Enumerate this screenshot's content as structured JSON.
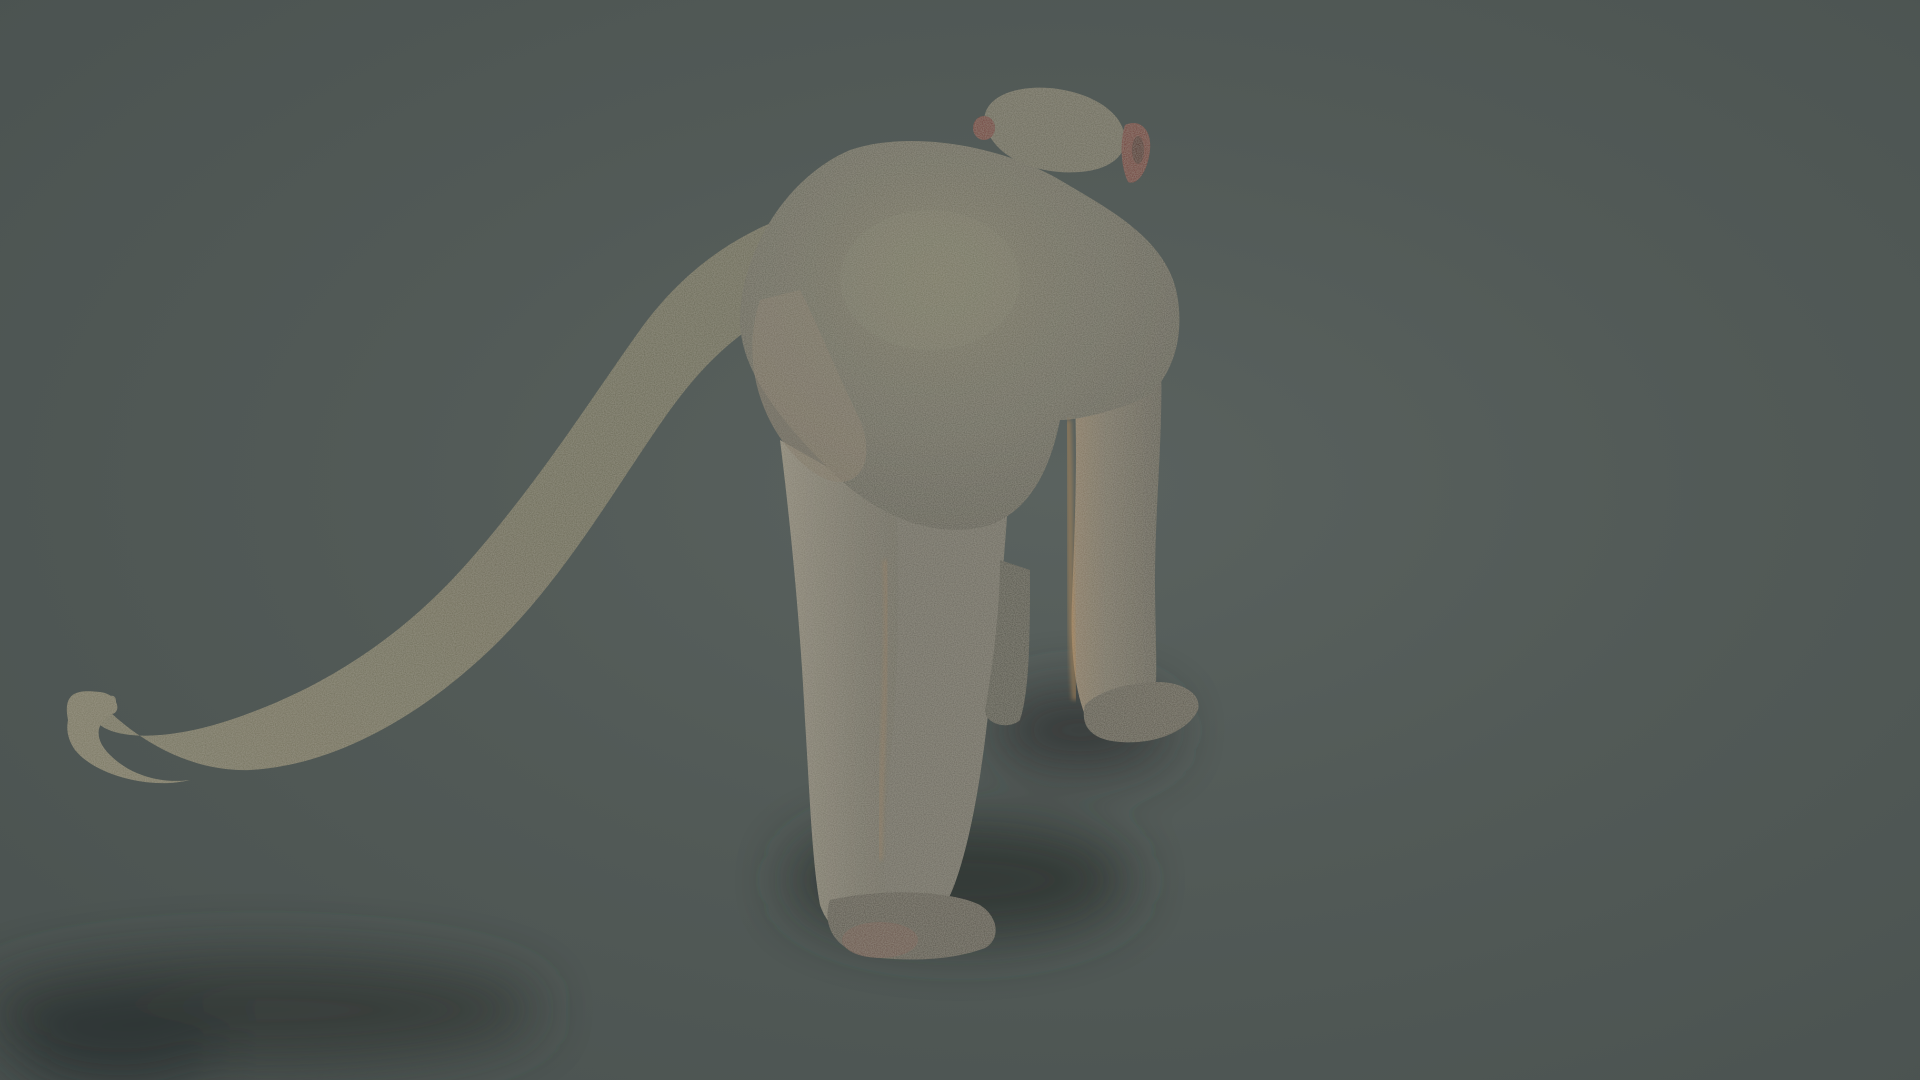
{
  "scene": {
    "background_color": "#525a57",
    "shadow_color": "#2e3432",
    "fur_color": "#6b6a5c",
    "fur_highlight": "#8a8574",
    "fur_shadow": "#4b4a40",
    "skin_color": "#5a3f38",
    "ear_color": "#6e3a34",
    "subject": "monkey"
  }
}
